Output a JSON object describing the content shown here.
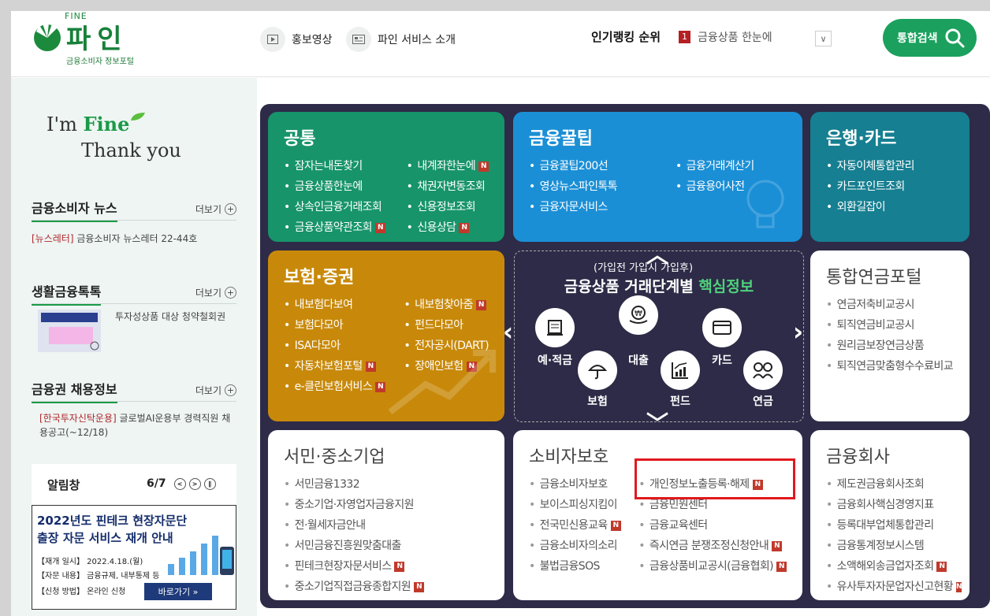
{
  "header": {
    "logo": {
      "fine": "FINE",
      "title": "파인",
      "subtitle": "금융소비자 정보포털"
    },
    "nav": [
      {
        "label": "홍보영상"
      },
      {
        "label": "파인 서비스 소개"
      }
    ],
    "ranking": {
      "label": "인기랭킹 순위",
      "number": "1",
      "item": "금융상품 한눈에"
    },
    "search_button": "통합검색"
  },
  "left": {
    "slogan1a": "I'm ",
    "slogan1b": "Fine",
    "slogan2": "Thank you",
    "more": "더보기",
    "news": {
      "title": "금융소비자 뉴스",
      "tag": "[뉴스레터]",
      "text": " 금융소비자 뉴스레터 22-44호"
    },
    "life": {
      "title": "생활금융톡톡",
      "text": "투자성상품 대상 청약철회권"
    },
    "jobs": {
      "title": "금융권 채용정보",
      "tag": "[한국투자신탁운용]",
      "text": " 글로벌AI운용부 경력직원 채용공고(~12/18)"
    },
    "notice": {
      "title": "알림창",
      "page": "6/7",
      "banner_title1": "2022년도 핀테크 현장자문단",
      "banner_title2": "출장 자문 서비스 재개 안내",
      "lines": [
        "【재개 일시】 2022.4.18.(월)",
        "【자문 내용】 금융규제, 내부통제 등",
        "【신청 방법】 온라인 신청"
      ],
      "button": "바로가기  »"
    }
  },
  "cards": {
    "common": {
      "title": "공통",
      "left": [
        "잠자는내돈찾기",
        "금융상품한눈에",
        "상속인금융거래조회",
        "금융상품약관조회"
      ],
      "right": [
        "내계좌한눈에",
        "채권자변동조회",
        "신용정보조회",
        "신용상담"
      ],
      "new_left": [
        false,
        false,
        false,
        true
      ],
      "new_right": [
        true,
        false,
        false,
        true
      ]
    },
    "tips": {
      "title": "금융꿀팁",
      "left": [
        "금융꿀팁200선",
        "영상뉴스파인톡톡",
        "금융자문서비스"
      ],
      "right": [
        "금융거래계산기",
        "금융용어사전"
      ]
    },
    "bank": {
      "title": "은행·카드",
      "items": [
        "자동이체통합관리",
        "카드포인트조회",
        "외환길잡이"
      ]
    },
    "insurance": {
      "title": "보험·증권",
      "left": [
        "내보험다보여",
        "보험다모아",
        "ISA다모아",
        "자동차보험포털",
        "e-클린보험서비스"
      ],
      "right": [
        "내보험찾아줌",
        "펀드다모아",
        "전자공시(DART)",
        "장애인보험"
      ],
      "new_left": [
        false,
        false,
        false,
        true,
        true
      ],
      "new_right": [
        true,
        false,
        false,
        true
      ]
    },
    "center": {
      "subtitle": "(가입전 가입시 가입후)",
      "title": "금융상품 거래단계별 ",
      "title_hl": "핵심정보",
      "icons": [
        "예·적금",
        "대출",
        "카드",
        "보험",
        "펀드",
        "연금"
      ]
    },
    "pension": {
      "title": "통합연금포털",
      "items": [
        "연금저축비교공시",
        "퇴직연금비교공시",
        "원리금보장연금상품",
        "퇴직연금맞춤형수수료비교"
      ]
    },
    "sme": {
      "title": "서민·중소기업",
      "items": [
        "서민금융1332",
        "중소기업·자영업자금융지원",
        "전·월세자금안내",
        "서민금융진흥원맞춤대출",
        "핀테크현장자문서비스",
        "중소기업직접금융종합지원"
      ],
      "new": [
        false,
        false,
        false,
        false,
        true,
        true
      ]
    },
    "consumer": {
      "title": "소비자보호",
      "left": [
        "금융소비자보호",
        "보이스피싱지킴이",
        "전국민신용교육",
        "금융소비자의소리",
        "불법금융SOS"
      ],
      "right": [
        "개인정보노출등록·해제",
        "금융민원센터",
        "금융교육센터",
        "즉시연금 분쟁조정신청안내",
        "금융상품비교공시(금융협회)"
      ],
      "new_left": [
        false,
        false,
        true,
        false,
        false
      ],
      "new_right": [
        true,
        false,
        false,
        true,
        true
      ]
    },
    "firms": {
      "title": "금융회사",
      "items": [
        "제도권금융회사조회",
        "금융회사핵심경영지표",
        "등록대부업체통합관리",
        "금융통계정보시스템",
        "소액해외송금업자조회",
        "유사투자자문업자신고현황"
      ],
      "new": [
        false,
        false,
        false,
        false,
        true,
        true
      ]
    }
  },
  "new_badge": "N",
  "colors": {
    "brand": "#1ba15d",
    "board": "#2d2b47",
    "highlight": "#e0191f"
  }
}
